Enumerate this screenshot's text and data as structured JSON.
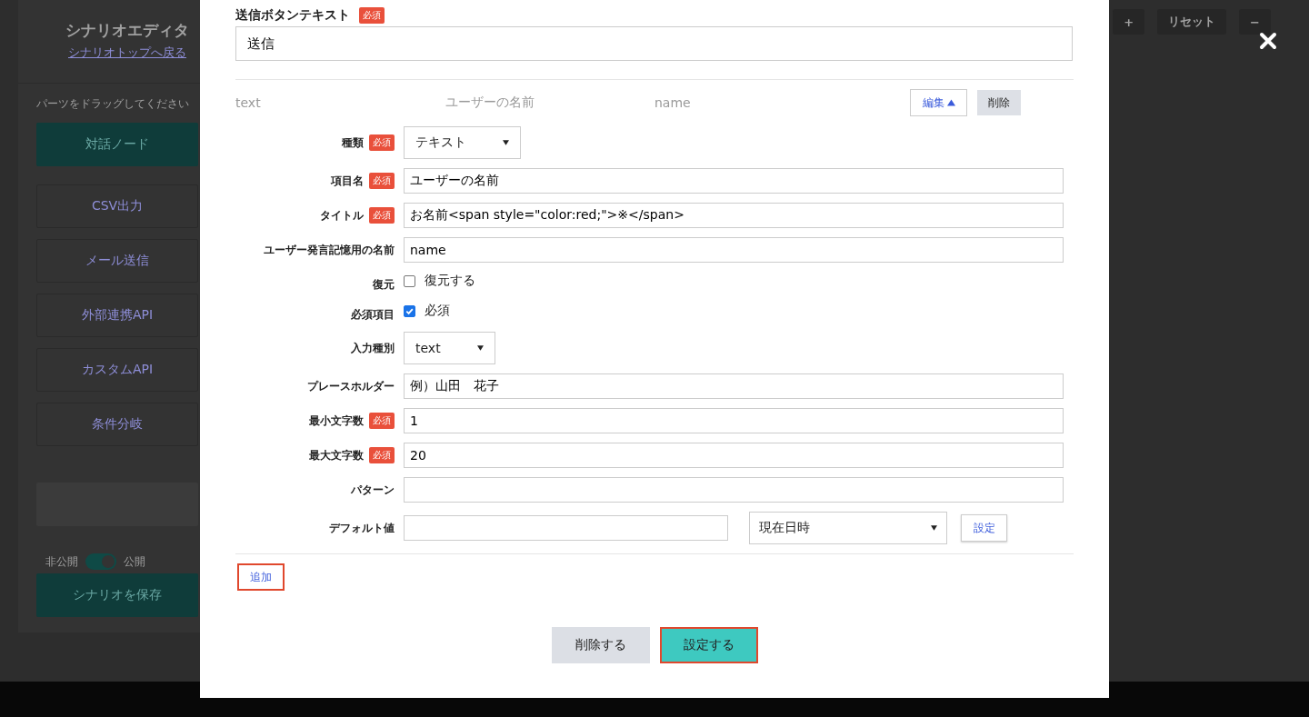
{
  "sidebar": {
    "title": "シナリオエディタ",
    "back_link": "シナリオトップへ戻る",
    "hint": "パーツをドラッグしてください",
    "parts": [
      {
        "label": "対話ノード",
        "kind": "primary"
      },
      {
        "label": "CSV出力",
        "kind": "outline"
      },
      {
        "label": "メール送信",
        "kind": "outline"
      },
      {
        "label": "外部連携API",
        "kind": "outline"
      },
      {
        "label": "カスタムAPI",
        "kind": "outline"
      },
      {
        "label": "条件分岐",
        "kind": "outline"
      },
      {
        "kind": "blank"
      }
    ],
    "visibility": {
      "off_label": "非公開",
      "on_label": "公開",
      "on": true
    },
    "save_button": "シナリオを保存"
  },
  "canvas_toolbar": [
    "+",
    "リセット",
    "−"
  ],
  "dialog": {
    "submit_text": {
      "label": "送信ボタンテキスト",
      "badge": "必須",
      "value": "送信"
    },
    "item_summary": {
      "type": "text",
      "name": "ユーザーの名前",
      "key": "name",
      "edit_button": "編集",
      "delete_button": "削除"
    },
    "fields": [
      {
        "kind": "select",
        "label": "種類",
        "badge": "必須",
        "value": "テキスト"
      },
      {
        "kind": "text",
        "label": "項目名",
        "badge": "必須",
        "value": "ユーザーの名前"
      },
      {
        "kind": "text",
        "label": "タイトル",
        "badge": "必須",
        "value": "お名前<span style=\"color:red;\">※</span>"
      },
      {
        "kind": "text",
        "label": "ユーザー発言記憶用の名前",
        "value": "name"
      },
      {
        "kind": "checkbox",
        "label": "復元",
        "option": "復元する",
        "checked": false
      },
      {
        "kind": "checkbox",
        "label": "必須項目",
        "option": "必須",
        "checked": true
      },
      {
        "kind": "select",
        "label": "入力種別",
        "value": "text"
      },
      {
        "kind": "text",
        "label": "プレースホルダー",
        "value": "例）山田　花子"
      },
      {
        "kind": "text",
        "label": "最小文字数",
        "badge": "必須",
        "value": "1"
      },
      {
        "kind": "text",
        "label": "最大文字数",
        "badge": "必須",
        "value": "20"
      },
      {
        "kind": "text",
        "label": "パターン"
      },
      {
        "kind": "default",
        "label": "デフォルト値",
        "select_value": "現在日時",
        "button": "設定"
      }
    ],
    "add_button": {
      "label": "追加",
      "highlighted": true
    },
    "footer_buttons": [
      {
        "label": "削除する",
        "kind": "secondary",
        "highlighted": false
      },
      {
        "label": "設定する",
        "kind": "primary",
        "highlighted": true
      }
    ]
  }
}
